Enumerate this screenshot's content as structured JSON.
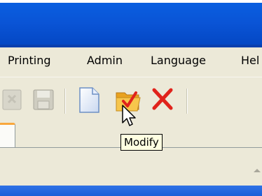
{
  "menu": {
    "items": [
      {
        "label": "Printing"
      },
      {
        "label": "Admin"
      },
      {
        "label": "Language"
      },
      {
        "label": "Hel"
      }
    ]
  },
  "toolbar": {
    "buttons": [
      {
        "name": "partial-disabled-icon",
        "enabled": false
      },
      {
        "name": "save-icon",
        "enabled": false
      },
      {
        "name": "new-document-icon",
        "enabled": true
      },
      {
        "name": "modify-folder-icon",
        "enabled": true,
        "hovered": true
      },
      {
        "name": "delete-x-icon",
        "enabled": true
      }
    ]
  },
  "tooltip": {
    "text": "Modify"
  },
  "colors": {
    "titlebar": "#0a54d6",
    "face": "#ece9d8",
    "tab_highlight": "#f9a73c",
    "tooltip_bg": "#ffffe1",
    "delete_red": "#e0231b"
  }
}
